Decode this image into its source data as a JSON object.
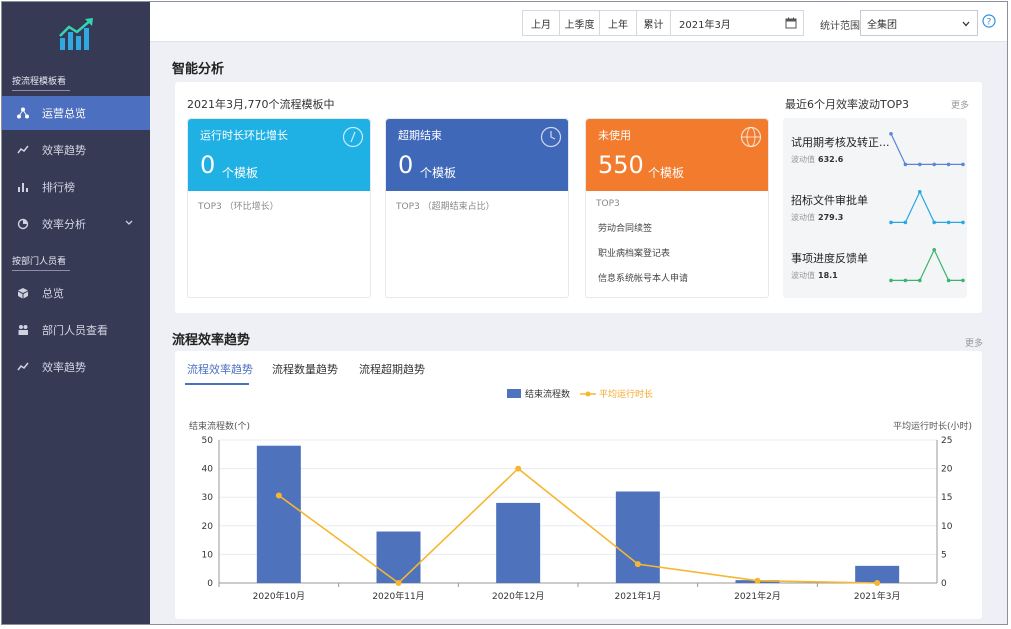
{
  "sidebar": {
    "group1": "按流程模板看",
    "items1": [
      {
        "label": "运营总览",
        "icon": "network-icon",
        "active": true
      },
      {
        "label": "效率趋势",
        "icon": "trend-line-icon"
      },
      {
        "label": "排行榜",
        "icon": "bar-chart-icon"
      },
      {
        "label": "效率分析",
        "icon": "pie-chart-icon",
        "expandable": true
      }
    ],
    "group2": "按部门人员看",
    "items2": [
      {
        "label": "总览",
        "icon": "cube-icon"
      },
      {
        "label": "部门人员查看",
        "icon": "people-icon"
      },
      {
        "label": "效率趋势",
        "icon": "trend-line-icon"
      }
    ]
  },
  "topbar": {
    "btn_last_month": "上月",
    "btn_last_quarter": "上季度",
    "btn_last_year": "上年",
    "btn_cumulative": "累计",
    "date_value": "2021年3月",
    "scope_label": "统计范围",
    "scope_value": "全集团"
  },
  "smart": {
    "title": "智能分析",
    "subtitle": "2021年3月,770个流程模板中",
    "cards": [
      {
        "title": "运行时长环比增长",
        "value": "0",
        "unit": "个模板",
        "footer": "TOP3 （环比增长）",
        "color": "#1fb1e3",
        "icon": "clock-icon"
      },
      {
        "title": "超期结束",
        "value": "0",
        "unit": "个模板",
        "footer": "TOP3 （超期结束占比）",
        "color": "#3f68b8",
        "icon": "clock-icon"
      },
      {
        "title": "未使用",
        "value": "550",
        "unit": "个模板",
        "footer": "TOP3",
        "color": "#f27b2e",
        "icon": "globe-icon",
        "list": [
          "劳动合同续签",
          "职业病档案登记表",
          "信息系统帐号本人申请"
        ]
      }
    ],
    "top3": {
      "title": "最近6个月效率波动TOP3",
      "more": "更多",
      "value_label": "波动值",
      "items": [
        {
          "name": "试用期考核及转正...",
          "value": "632.6",
          "color": "#5b86d6",
          "points": [
            0.95,
            0.1,
            0.1,
            0.1,
            0.1,
            0.1
          ]
        },
        {
          "name": "招标文件审批单",
          "value": "279.3",
          "color": "#2aa7e0",
          "points": [
            0.1,
            0.1,
            0.95,
            0.1,
            0.1,
            0.1
          ]
        },
        {
          "name": "事项进度反馈单",
          "value": "18.1",
          "color": "#3cb371",
          "points": [
            0.1,
            0.1,
            0.1,
            0.95,
            0.1,
            0.1
          ]
        }
      ]
    }
  },
  "trend": {
    "title": "流程效率趋势",
    "more": "更多",
    "tabs": [
      "流程效率趋势",
      "流程数量趋势",
      "流程超期趋势"
    ]
  },
  "chart_data": {
    "type": "bar",
    "categories": [
      "2020年10月",
      "2020年11月",
      "2020年12月",
      "2021年1月",
      "2021年2月",
      "2021年3月"
    ],
    "series": [
      {
        "name": "结束流程数",
        "type": "bar",
        "axis": "left",
        "color": "#4f72bd",
        "values": [
          48,
          18,
          28,
          32,
          1,
          6
        ]
      },
      {
        "name": "平均运行时长",
        "type": "line",
        "axis": "right",
        "color": "#f5b731",
        "values": [
          15.3,
          0,
          20,
          3.3,
          0.4,
          0
        ]
      }
    ],
    "ylabel": "结束流程数(个)",
    "y2label": "平均运行时长(小时)",
    "ylim": [
      0,
      50
    ],
    "y2lim": [
      0,
      25
    ],
    "yticks": [
      0,
      10,
      20,
      30,
      40,
      50
    ],
    "y2ticks": [
      0,
      5,
      10,
      15,
      20,
      25
    ],
    "grid": true,
    "legend": "top-center"
  }
}
